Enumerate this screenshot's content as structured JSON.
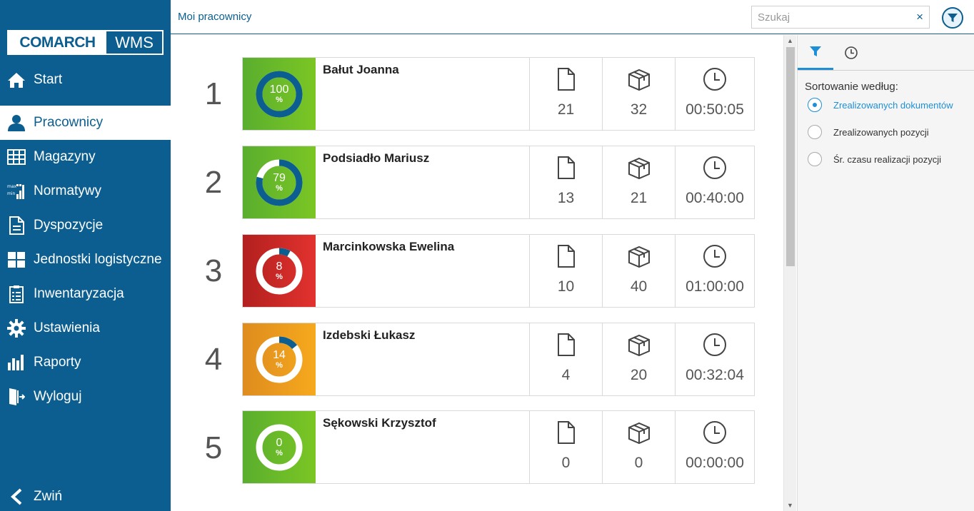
{
  "sidebar": {
    "logo_brand": "COMARCH",
    "logo_product": "WMS",
    "items": [
      {
        "label": "Start",
        "icon": "home-icon"
      },
      {
        "label": "Pracownicy",
        "icon": "user-icon",
        "active": true
      },
      {
        "label": "Magazyny",
        "icon": "warehouse-grid-icon"
      },
      {
        "label": "Normatywy",
        "icon": "min-max-chart-icon"
      },
      {
        "label": "Dyspozycje",
        "icon": "document-icon"
      },
      {
        "label": "Jednostki logistyczne",
        "icon": "pallet-grid-icon"
      },
      {
        "label": "Inwentaryzacja",
        "icon": "clipboard-checklist-icon"
      },
      {
        "label": "Ustawienia",
        "icon": "gear-icon"
      },
      {
        "label": "Raporty",
        "icon": "bar-chart-icon"
      },
      {
        "label": "Wyloguj",
        "icon": "logout-door-icon"
      }
    ],
    "collapse_label": "Zwiń"
  },
  "header": {
    "breadcrumb": "Moi pracownicy",
    "search_placeholder": "Szukaj",
    "clear_symbol": "×"
  },
  "employees": [
    {
      "rank": "1",
      "name": "Bałut Joanna",
      "percent": "100",
      "percent_value": 100,
      "percent_sign": "%",
      "badge": "green",
      "documents": "21",
      "positions": "32",
      "time": "00:50:05"
    },
    {
      "rank": "2",
      "name": "Podsiadło Mariusz",
      "percent": "79",
      "percent_value": 79,
      "percent_sign": "%",
      "badge": "green",
      "documents": "13",
      "positions": "21",
      "time": "00:40:00"
    },
    {
      "rank": "3",
      "name": "Marcinkowska Ewelina",
      "percent": "8",
      "percent_value": 8,
      "percent_sign": "%",
      "badge": "red",
      "documents": "10",
      "positions": "40",
      "time": "01:00:00"
    },
    {
      "rank": "4",
      "name": "Izdebski Łukasz",
      "percent": "14",
      "percent_value": 14,
      "percent_sign": "%",
      "badge": "orange",
      "documents": "4",
      "positions": "20",
      "time": "00:32:04"
    },
    {
      "rank": "5",
      "name": "Sękowski Krzysztof",
      "percent": "0",
      "percent_value": 0,
      "percent_sign": "%",
      "badge": "green",
      "documents": "0",
      "positions": "0",
      "time": "00:00:00"
    }
  ],
  "right_panel": {
    "tabs": [
      "filter-icon",
      "clock-icon"
    ],
    "sort_title": "Sortowanie według:",
    "options": [
      {
        "label": "Zrealizowanych dokumentów",
        "selected": true
      },
      {
        "label": "Zrealizowanych pozycji",
        "selected": false
      },
      {
        "label": "Śr. czasu realizacji pozycji",
        "selected": false
      }
    ]
  },
  "colors": {
    "primary": "#0b5e8f",
    "accent": "#1e8fd6",
    "green": "#6bbb28",
    "red": "#d22a28",
    "orange": "#f0a01e",
    "ring_progress": "#0b5e8f"
  }
}
